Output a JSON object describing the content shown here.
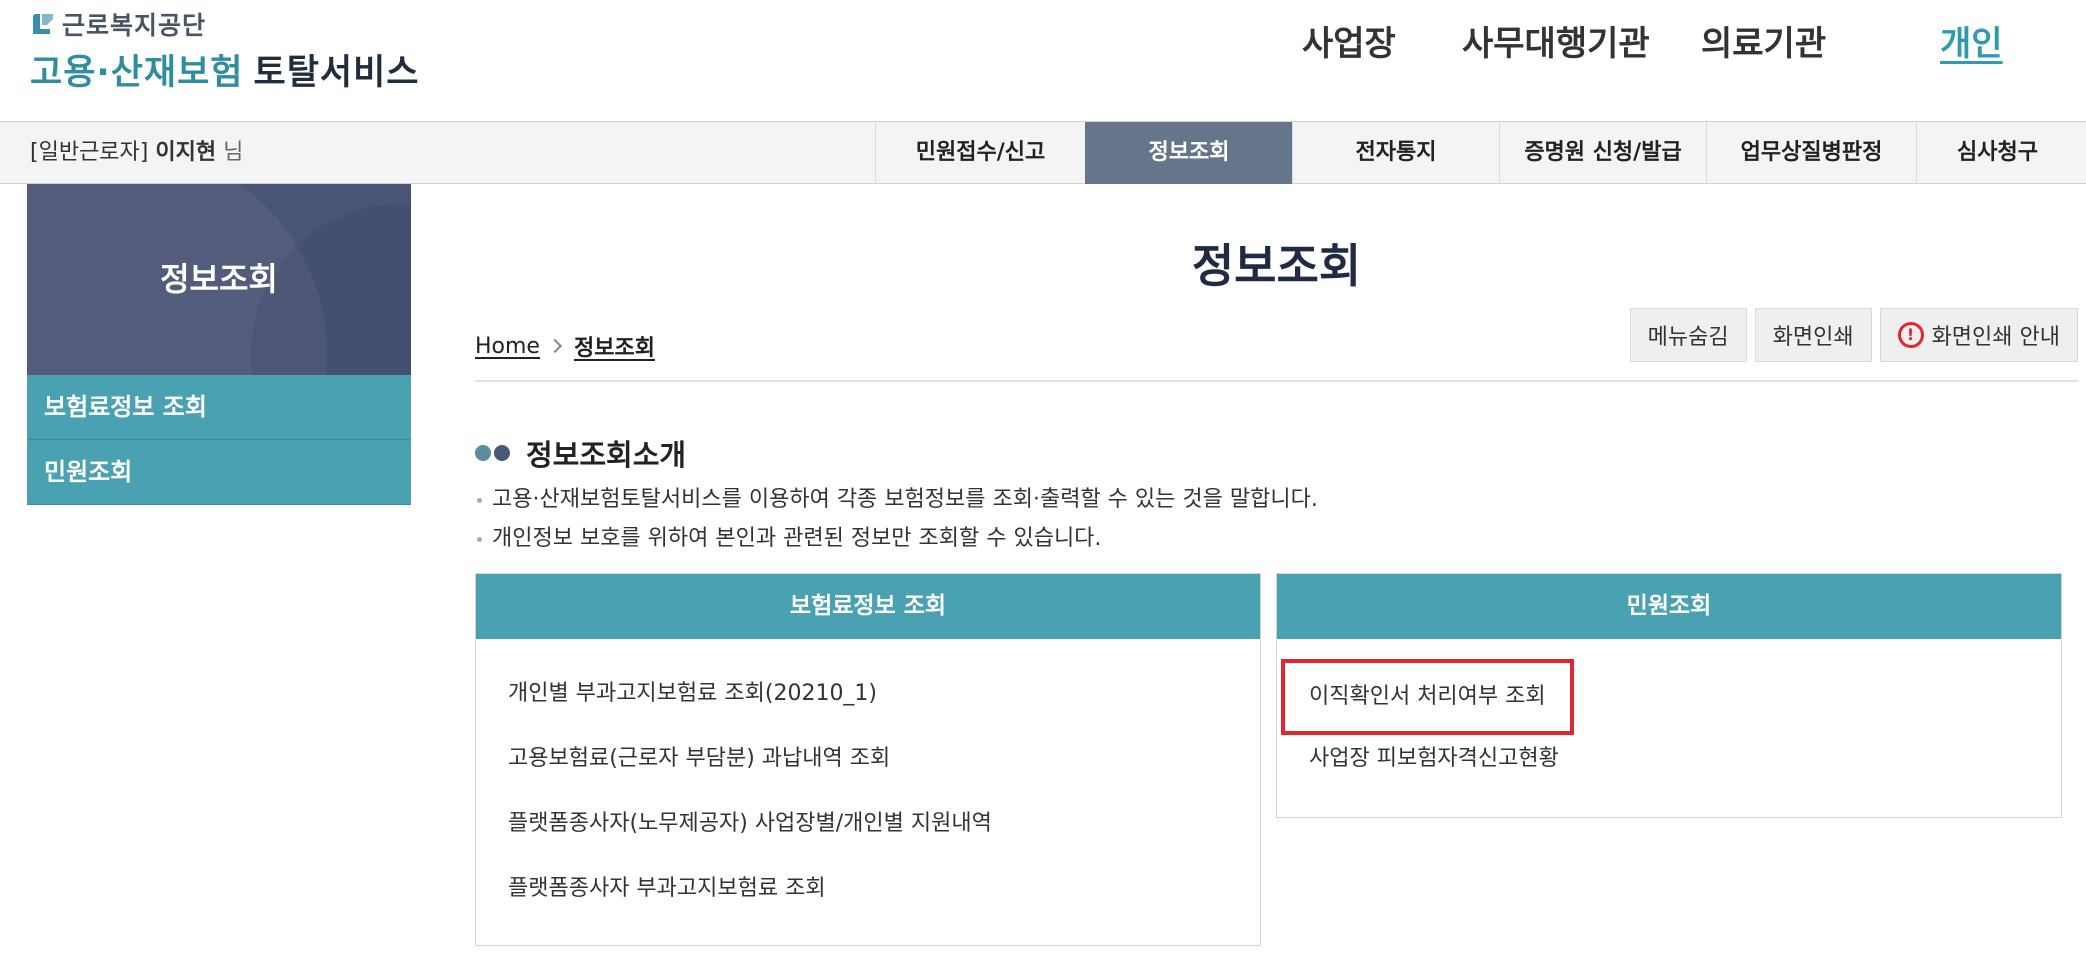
{
  "header": {
    "org_name": "근로복지공단",
    "service_name_a": "고용·산재보험",
    "service_name_b": "토탈서비스",
    "top_menu": [
      {
        "label": "사업장"
      },
      {
        "label": "사무대행기관"
      },
      {
        "label": "의료기관"
      },
      {
        "label": "개인",
        "active": true
      }
    ]
  },
  "user": {
    "type": "[일반근로자]",
    "name": "이지현",
    "honorific": "님"
  },
  "gnb": [
    {
      "label": "민원접수/신고"
    },
    {
      "label": "정보조회",
      "active": true
    },
    {
      "label": "전자통지"
    },
    {
      "label": "증명원 신청/발급"
    },
    {
      "label": "업무상질병판정"
    },
    {
      "label": "심사청구"
    }
  ],
  "sidebar": {
    "title": "정보조회",
    "items": [
      {
        "label": "보험료정보 조회"
      },
      {
        "label": "민원조회"
      }
    ]
  },
  "main": {
    "page_title": "정보조회",
    "breadcrumb": {
      "home": "Home",
      "current": "정보조회"
    },
    "tools": {
      "hide_menu": "메뉴숨김",
      "print": "화면인쇄",
      "print_guide": "화면인쇄 안내",
      "warning_glyph": "!"
    },
    "section_title": "정보조회소개",
    "descriptions": [
      "고용·산재보험토탈서비스를 이용하여 각종 보험정보를 조회·출력할 수 있는 것을 말합니다.",
      "개인정보 보호를 위하여 본인과 관련된 정보만 조회할 수 있습니다."
    ],
    "panels": [
      {
        "title": "보험료정보 조회",
        "links": [
          "개인별 부과고지보험료 조회(20210_1)",
          "고용보험료(근로자 부담분) 과납내역 조회",
          "플랫폼종사자(노무제공자) 사업장별/개인별 지원내역",
          "플랫폼종사자 부과고지보험료 조회"
        ]
      },
      {
        "title": "민원조회",
        "links": [
          "이직확인서 처리여부 조회",
          "사업장 피보험자격신고현황"
        ]
      }
    ]
  },
  "colors": {
    "teal": "#4aa1b2",
    "navy": "#4a5476",
    "gnb_active": "#66768a",
    "highlight_red": "#e0262e",
    "active_link": "#2f9ab0"
  },
  "icons": [
    "logo-mark-icon",
    "chevron-right-icon",
    "warning-circle-icon",
    "bullet-dots-icon"
  ]
}
